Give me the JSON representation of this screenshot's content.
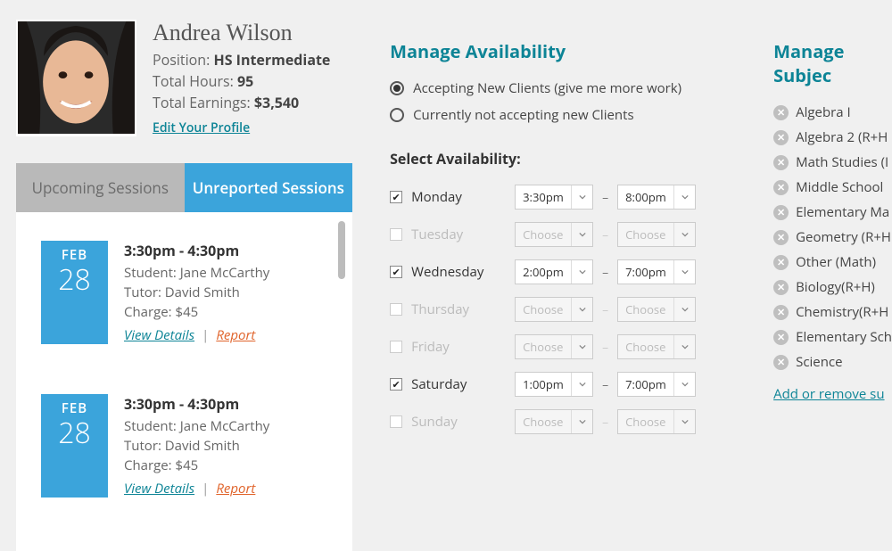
{
  "profile": {
    "name": "Andrea Wilson",
    "position_label": "Position:",
    "position_value": "HS Intermediate",
    "hours_label": "Total Hours:",
    "hours_value": "95",
    "earnings_label": "Total Earnings:",
    "earnings_value": "$3,540",
    "edit_link": "Edit Your Profile"
  },
  "tabs": {
    "upcoming": "Upcoming Sessions",
    "unreported": "Unreported Sessions"
  },
  "sessions": [
    {
      "month": "FEB",
      "day": "28",
      "time": "3:30pm - 4:30pm",
      "student_label": "Student:",
      "student_value": "Jane McCarthy",
      "tutor_label": "Tutor:",
      "tutor_value": "David Smith",
      "charge_label": "Charge:",
      "charge_value": "$45",
      "view_link": "View Details",
      "sep": "|",
      "report_link": "Report"
    },
    {
      "month": "FEB",
      "day": "28",
      "time": "3:30pm - 4:30pm",
      "student_label": "Student:",
      "student_value": "Jane McCarthy",
      "tutor_label": "Tutor:",
      "tutor_value": "David Smith",
      "charge_label": "Charge:",
      "charge_value": "$45",
      "view_link": "View Details",
      "sep": "|",
      "report_link": "Report"
    }
  ],
  "availability": {
    "title": "Manage Availability",
    "radio_accept": "Accepting New Clients (give me more work)",
    "radio_decline": "Currently not accepting new Clients",
    "select_label": "Select Availability:",
    "placeholder": "Choose",
    "dash": "–",
    "days": [
      {
        "name": "Monday",
        "checked": true,
        "start": "3:30pm",
        "end": "8:00pm"
      },
      {
        "name": "Tuesday",
        "checked": false,
        "start": "Choose",
        "end": "Choose"
      },
      {
        "name": "Wednesday",
        "checked": true,
        "start": "2:00pm",
        "end": "7:00pm"
      },
      {
        "name": "Thursday",
        "checked": false,
        "start": "Choose",
        "end": "Choose"
      },
      {
        "name": "Friday",
        "checked": false,
        "start": "Choose",
        "end": "Choose"
      },
      {
        "name": "Saturday",
        "checked": true,
        "start": "1:00pm",
        "end": "7:00pm"
      },
      {
        "name": "Sunday",
        "checked": false,
        "start": "Choose",
        "end": "Choose"
      }
    ]
  },
  "subjects": {
    "title": "Manage Subjec",
    "items": [
      "Algebra I",
      "Algebra 2 (R+H",
      "Math Studies (I",
      "Middle School ",
      "Elementary Ma",
      "Geometry (R+H",
      "Other (Math)",
      "Biology(R+H)",
      "Chemistry(R+H",
      "Elementary Sch",
      "Science"
    ],
    "add_link": "Add or remove su"
  }
}
